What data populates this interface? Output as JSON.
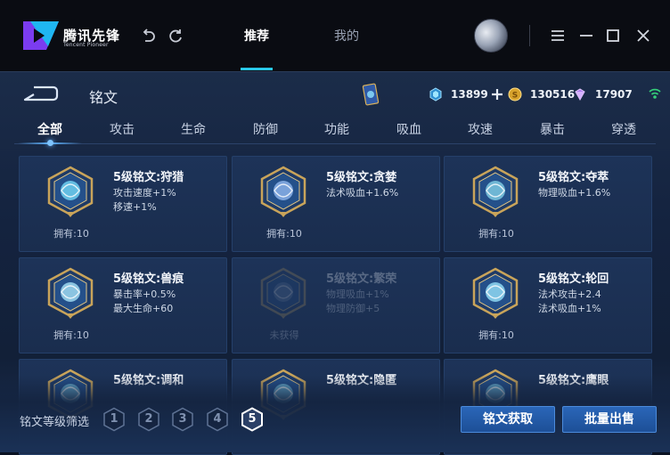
{
  "app": {
    "logo_text": "腾讯先锋",
    "logo_subtext": "Tencent Pioneer",
    "tabs": [
      {
        "label": "推荐",
        "active": true
      },
      {
        "label": "我的",
        "active": false
      }
    ]
  },
  "page": {
    "title": "铭文",
    "currencies": [
      {
        "icon": "diamond-coin-icon",
        "value": "13899",
        "has_add": true
      },
      {
        "icon": "gold-coin-icon",
        "value": "130516"
      },
      {
        "icon": "purple-crystal-icon",
        "value": "17907"
      }
    ]
  },
  "categories": [
    "全部",
    "攻击",
    "生命",
    "防御",
    "功能",
    "吸血",
    "攻速",
    "暴击",
    "穿透"
  ],
  "active_category": "全部",
  "inscriptions": [
    {
      "name": "5级铭文:狩猎",
      "attr1": "攻击速度+1%",
      "attr2": "移速+1%",
      "owned": "拥有:10",
      "color": "#6fd0f0",
      "locked": false
    },
    {
      "name": "5级铭文:贪婪",
      "attr1": "法术吸血+1.6%",
      "attr2": "",
      "owned": "拥有:10",
      "color": "#8ab0e8",
      "locked": false
    },
    {
      "name": "5级铭文:夺萃",
      "attr1": "物理吸血+1.6%",
      "attr2": "",
      "owned": "拥有:10",
      "color": "#7cc8e0",
      "locked": false
    },
    {
      "name": "5级铭文:兽痕",
      "attr1": "暴击率+0.5%",
      "attr2": "最大生命+60",
      "owned": "拥有:10",
      "color": "#9ed8f0",
      "locked": false
    },
    {
      "name": "5级铭文:繁荣",
      "attr1": "物理吸血+1%",
      "attr2": "物理防御+5",
      "owned": "未获得",
      "color": "#6e8fb8",
      "locked": true
    },
    {
      "name": "5级铭文:轮回",
      "attr1": "法术攻击+2.4",
      "attr2": "法术吸血+1%",
      "owned": "拥有:10",
      "color": "#8fd8f2",
      "locked": false
    },
    {
      "name": "5级铭文:调和",
      "attr1": "",
      "attr2": "",
      "owned": "",
      "color": "#6fb8d8",
      "locked": false
    },
    {
      "name": "5级铭文:隐匿",
      "attr1": "",
      "attr2": "",
      "owned": "",
      "color": "#6fb8d8",
      "locked": false
    },
    {
      "name": "5级铭文:鹰眼",
      "attr1": "",
      "attr2": "",
      "owned": "",
      "color": "#6fb8d8",
      "locked": false
    }
  ],
  "filter": {
    "label": "铭文等级筛选",
    "levels": [
      "1",
      "2",
      "3",
      "4",
      "5"
    ],
    "selected": "5"
  },
  "buttons": {
    "obtain": "铭文获取",
    "bulk_sell": "批量出售"
  },
  "colors": {
    "accent": "#29c8e8",
    "button": "#2a66b8",
    "gold": "#c9a45a"
  }
}
